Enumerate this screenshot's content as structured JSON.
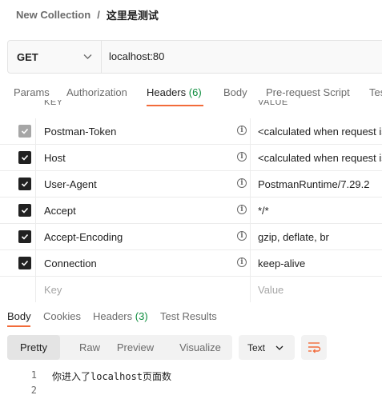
{
  "breadcrumb": {
    "collection": "New Collection",
    "separator": "/",
    "request": "这里是测试"
  },
  "request": {
    "method": "GET",
    "url": "localhost:80"
  },
  "request_tabs": [
    {
      "label": "Params"
    },
    {
      "label": "Authorization"
    },
    {
      "label": "Headers",
      "count": "(6)",
      "active": true
    },
    {
      "label": "Body"
    },
    {
      "label": "Pre-request Script"
    },
    {
      "label": "Tests"
    }
  ],
  "headers_table": {
    "columns": {
      "key": "KEY",
      "value": "VALUE"
    },
    "rows": [
      {
        "checked": true,
        "disabled": true,
        "key": "Postman-Token",
        "value": "<calculated when request is sent>"
      },
      {
        "checked": true,
        "disabled": false,
        "key": "Host",
        "value": "<calculated when request is sent>"
      },
      {
        "checked": true,
        "disabled": false,
        "key": "User-Agent",
        "value": "PostmanRuntime/7.29.2"
      },
      {
        "checked": true,
        "disabled": false,
        "key": "Accept",
        "value": "*/*"
      },
      {
        "checked": true,
        "disabled": false,
        "key": "Accept-Encoding",
        "value": "gzip, deflate, br"
      },
      {
        "checked": true,
        "disabled": false,
        "key": "Connection",
        "value": "keep-alive"
      }
    ],
    "new_row": {
      "key_placeholder": "Key",
      "value_placeholder": "Value"
    }
  },
  "response_tabs": [
    {
      "label": "Body",
      "active": true
    },
    {
      "label": "Cookies"
    },
    {
      "label": "Headers",
      "count": "(3)"
    },
    {
      "label": "Test Results"
    }
  ],
  "format_options": [
    "Pretty",
    "Raw",
    "Preview",
    "Visualize"
  ],
  "selected_format": "Pretty",
  "language": "Text",
  "response_body": {
    "lines": [
      "1",
      "2"
    ],
    "content": "你进入了localhost页面数"
  },
  "colors": {
    "accent": "#f26b3a",
    "count_green": "#0c8c3c",
    "checkbox": "#212121",
    "checkbox_disabled": "#a6a6a6"
  }
}
